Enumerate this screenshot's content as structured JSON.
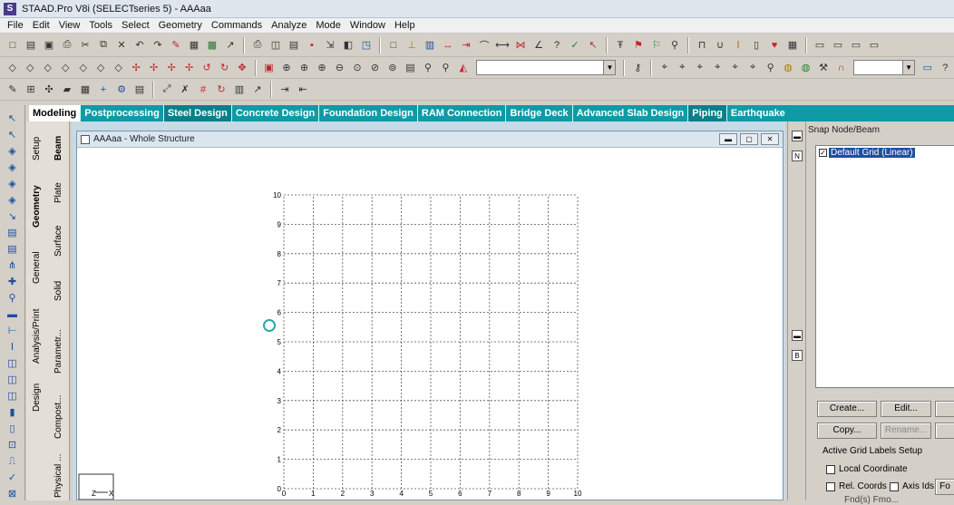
{
  "window": {
    "title": "STAAD.Pro V8i (SELECTseries 5) - AAAaa",
    "app_icon": "staad-logo-icon"
  },
  "menu": [
    "File",
    "Edit",
    "View",
    "Tools",
    "Select",
    "Geometry",
    "Commands",
    "Analyze",
    "Mode",
    "Window",
    "Help"
  ],
  "page_tabs": [
    "Modeling",
    "Postprocessing",
    "Steel Design",
    "Concrete Design",
    "Foundation Design",
    "RAM Connection",
    "Bridge Deck",
    "Advanced Slab Design",
    "Piping",
    "Earthquake"
  ],
  "side_tabs": {
    "setup": "Setup",
    "geometry": "Geometry",
    "general": "General",
    "analysis_print": "Analysis/Print",
    "design": "Design",
    "beam": "Beam",
    "plate": "Plate",
    "surface": "Surface",
    "solid": "Solid",
    "parametric": "Parametr...",
    "composite": "Compost...",
    "physical": "Physical ..."
  },
  "structure_window": {
    "title": "AAAaa - Whole Structure",
    "grid_x_labels": [
      "0",
      "1",
      "2",
      "3",
      "4",
      "5",
      "6",
      "7",
      "8",
      "9",
      "10"
    ],
    "grid_y_labels": [
      "0",
      "1",
      "2",
      "3",
      "4",
      "5",
      "6",
      "7",
      "8",
      "9",
      "10"
    ],
    "axis_x_label": "X",
    "axis_z_label": "Z"
  },
  "snap_panel": {
    "title": "Snap Node/Beam",
    "grid_item": "Default Grid (Linear)",
    "grid_item_checked": true,
    "buttons": {
      "create": "Create...",
      "edit": "Edit...",
      "copy": "Copy...",
      "rename": "Rename..."
    },
    "labels_setup": "Active Grid Labels Setup",
    "local_coordinate": "Local Coordinate",
    "rel_coords": "Rel. Coords",
    "axis_ids": "Axis Ids",
    "fo_button": "Fo",
    "footer_partial": "Fnd(s)     Fmo..."
  },
  "colors": {
    "tab_bar": "#0f9aa6",
    "mdi_bg": "#c7dbe7",
    "grid_line": "#555555",
    "selection": "#1d4fa1"
  }
}
